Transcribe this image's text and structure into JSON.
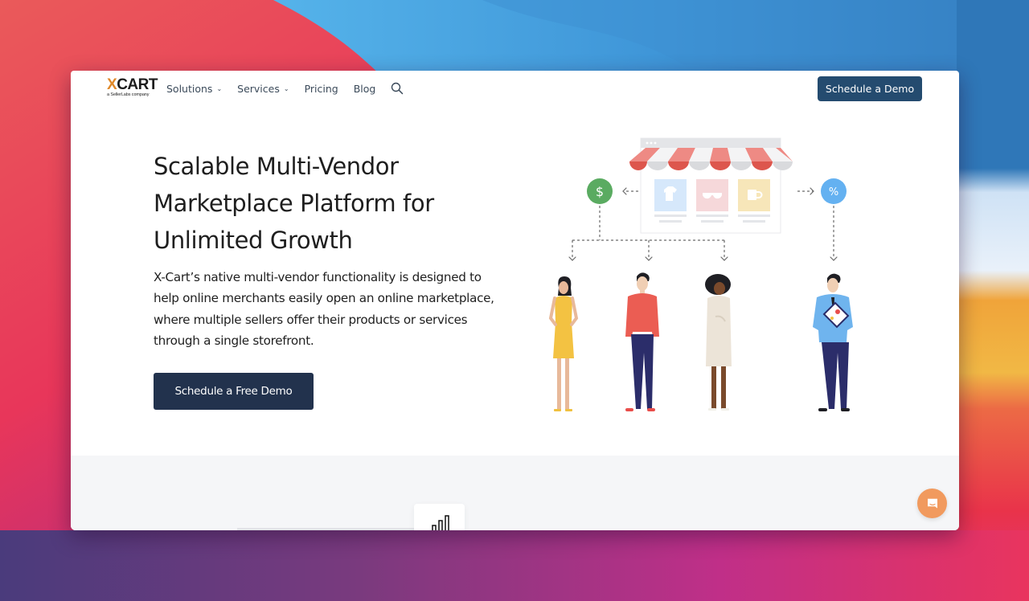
{
  "brand": {
    "logo_prefix": "X",
    "logo_rest": "CART",
    "logo_tagline": "a SellerLabs company",
    "accent_color": "#e0892a"
  },
  "nav": {
    "items": [
      {
        "label": "Solutions",
        "has_dropdown": true
      },
      {
        "label": "Services",
        "has_dropdown": true
      },
      {
        "label": "Pricing",
        "has_dropdown": false
      },
      {
        "label": "Blog",
        "has_dropdown": false
      }
    ],
    "dropdown_glyph": "⌄",
    "search_icon": "search-icon",
    "cta_label": "Schedule a Demo",
    "cta_color": "#244b6f"
  },
  "hero": {
    "title": "Scalable Multi-Vendor Marketplace Platform for Unlimited Growth",
    "description": "X-Cart’s native multi-vendor functionality is designed to help online merchants easily open an online marketplace, where multiple sellers offer their products or services through a single storefront.",
    "cta_label": "Schedule a Free Demo",
    "cta_color": "#22324d"
  },
  "illustration": {
    "left_badge_symbol": "$",
    "right_badge_symbol": "%",
    "left_badge_color": "#5aab61",
    "right_badge_color": "#64b1f1",
    "products": [
      "t-shirt",
      "sunglasses",
      "mug"
    ],
    "people": [
      "woman-yellow-dress",
      "man-red-sweater",
      "woman-beige-dress",
      "man-blue-shirt-clipboard"
    ]
  },
  "chat": {
    "icon": "chat-icon",
    "color": "#f19a5e"
  }
}
